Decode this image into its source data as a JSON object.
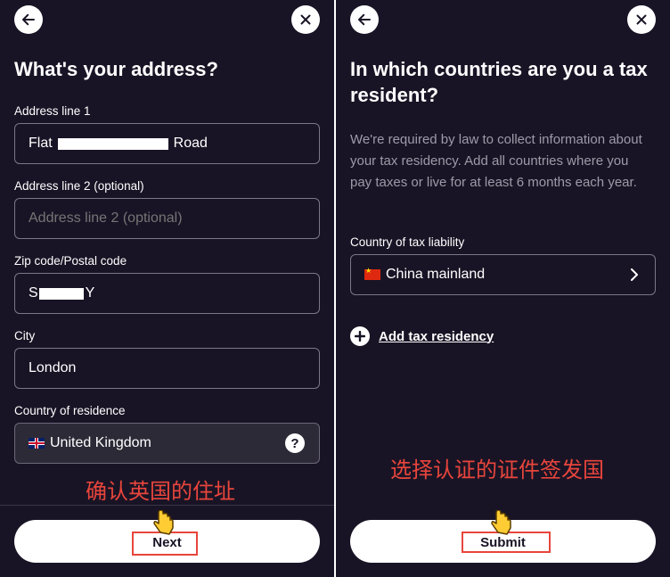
{
  "left": {
    "title": "What's your address?",
    "fields": {
      "address1": {
        "label": "Address line 1",
        "value_prefix": "Flat",
        "value_suffix": "Road"
      },
      "address2": {
        "label": "Address line 2 (optional)",
        "placeholder": "Address line 2 (optional)"
      },
      "zip": {
        "label": "Zip code/Postal code",
        "value_prefix": "S",
        "value_suffix": "Y"
      },
      "city": {
        "label": "City",
        "value": "London"
      },
      "country": {
        "label": "Country of residence",
        "value": "United Kingdom",
        "help": "?"
      }
    },
    "annotation": "确认英国的住址",
    "next_label": "Next"
  },
  "right": {
    "title": "In which countries are you a tax resident?",
    "description": "We're required by law to collect information about your tax residency. Add all countries where you pay taxes or live for at least 6 months each year.",
    "tax_country": {
      "label": "Country of tax liability",
      "value": "China mainland"
    },
    "add_label": "Add tax residency",
    "annotation": "选择认证的证件签发国",
    "submit_label": "Submit"
  },
  "colors": {
    "background": "#191425",
    "accent_red": "#e8453c",
    "white": "#ffffff"
  },
  "icons": [
    "back-arrow-icon",
    "close-icon",
    "uk-flag-icon",
    "help-icon",
    "china-flag-icon",
    "chevron-right-icon",
    "plus-icon",
    "pointer-hand-icon"
  ]
}
